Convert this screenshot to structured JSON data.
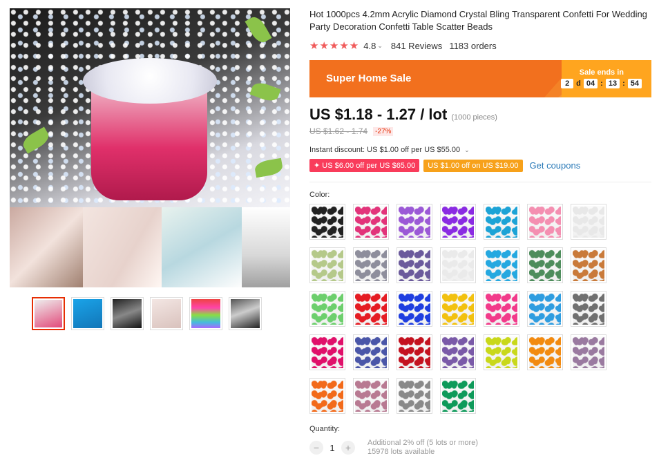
{
  "product": {
    "title": "Hot 1000pcs 4.2mm Acrylic Diamond Crystal Bling Transparent Confetti For Wedding Party Decoration Confetti Table Scatter Beads",
    "stars": "★★★★★",
    "rating": "4.8",
    "reviews": "841 Reviews",
    "orders": "1183 orders"
  },
  "sale": {
    "title": "Super Home Sale",
    "ends_label": "Sale ends in",
    "days": "2",
    "days_suffix": "d",
    "hours": "04",
    "minutes": "13",
    "seconds": "54",
    "sep": ":"
  },
  "price": {
    "current": "US $1.18 - 1.27 / lot",
    "unit": "(1000 pieces)",
    "original": "US $1.62 - 1.74",
    "discount": "-27%"
  },
  "coupons": {
    "instant": "Instant discount: US $1.00 off per US $55.00",
    "coupon_1": "✦ US $6.00 off per US $65.00",
    "coupon_2": "US $1.00 off on US $19.00",
    "get_coupons": "Get coupons"
  },
  "color": {
    "label": "Color:",
    "swatches": [
      "#222222",
      "#e2337a",
      "#9b59d6",
      "#8a2be2",
      "#1ca3d6",
      "#f48fb1",
      "#e8e8e8",
      "#b5c98a",
      "#8e8e9c",
      "#6b5a9c",
      "#eaeaea",
      "#25a8e0",
      "#4e8d5c",
      "#c97a3a",
      "#6dcf6d",
      "#e51c23",
      "#1f3ee0",
      "#f2c10f",
      "#f23a8a",
      "#2f9de0",
      "#707070",
      "#e0106a",
      "#4a56a8",
      "#c4121f",
      "#7a5aa8",
      "#c9d81a",
      "#f28a10",
      "#9a7aa0",
      "#f26a1a",
      "#b87a92",
      "#8a8a8a",
      "#0e9a5a"
    ]
  },
  "quantity": {
    "label": "Quantity:",
    "value": "1",
    "minus": "−",
    "plus": "+",
    "additional": "Additional 2% off (5 lots or more)",
    "available": "15978 lots available"
  }
}
